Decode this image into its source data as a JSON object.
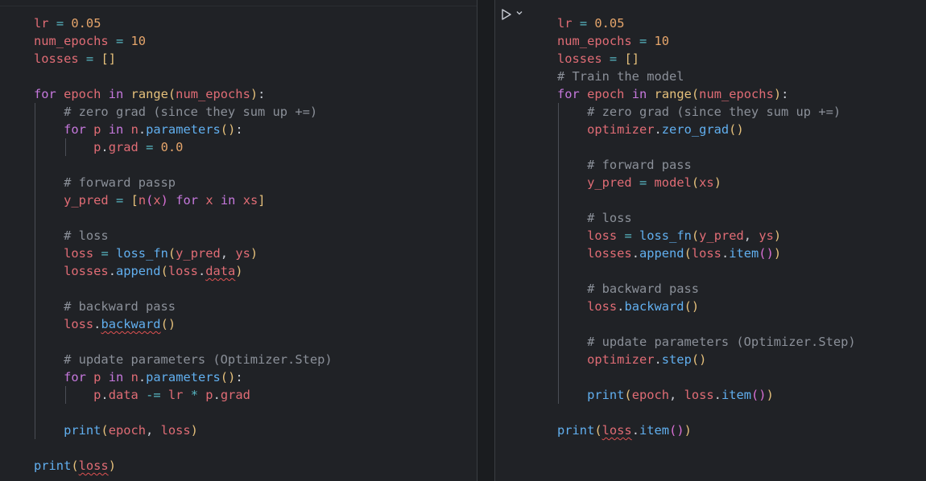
{
  "left_cell": {
    "lines": [
      [
        {
          "t": "lr",
          "c": "var"
        },
        {
          "t": " "
        },
        {
          "t": "=",
          "c": "op"
        },
        {
          "t": " "
        },
        {
          "t": "0.05",
          "c": "num"
        }
      ],
      [
        {
          "t": "num_epochs",
          "c": "var"
        },
        {
          "t": " "
        },
        {
          "t": "=",
          "c": "op"
        },
        {
          "t": " "
        },
        {
          "t": "10",
          "c": "num"
        }
      ],
      [
        {
          "t": "losses",
          "c": "var"
        },
        {
          "t": " "
        },
        {
          "t": "=",
          "c": "op"
        },
        {
          "t": " "
        },
        {
          "t": "[]",
          "c": "br1"
        }
      ],
      [],
      [
        {
          "t": "for",
          "c": "kw"
        },
        {
          "t": " "
        },
        {
          "t": "epoch",
          "c": "var"
        },
        {
          "t": " "
        },
        {
          "t": "in",
          "c": "kw"
        },
        {
          "t": " "
        },
        {
          "t": "range",
          "c": "bi"
        },
        {
          "t": "(",
          "c": "br1"
        },
        {
          "t": "num_epochs",
          "c": "var"
        },
        {
          "t": ")",
          "c": "br1"
        },
        {
          "t": ":"
        }
      ],
      [
        {
          "t": "    "
        },
        {
          "t": "# zero grad (since they sum up +=)",
          "c": "cm"
        }
      ],
      [
        {
          "t": "    "
        },
        {
          "t": "for",
          "c": "kw"
        },
        {
          "t": " "
        },
        {
          "t": "p",
          "c": "var"
        },
        {
          "t": " "
        },
        {
          "t": "in",
          "c": "kw"
        },
        {
          "t": " "
        },
        {
          "t": "n",
          "c": "var"
        },
        {
          "t": "."
        },
        {
          "t": "parameters",
          "c": "fn"
        },
        {
          "t": "()",
          "c": "br1"
        },
        {
          "t": ":"
        }
      ],
      [
        {
          "t": "        "
        },
        {
          "t": "p",
          "c": "var"
        },
        {
          "t": "."
        },
        {
          "t": "grad",
          "c": "var"
        },
        {
          "t": " "
        },
        {
          "t": "=",
          "c": "op"
        },
        {
          "t": " "
        },
        {
          "t": "0.0",
          "c": "num"
        }
      ],
      [],
      [
        {
          "t": "    "
        },
        {
          "t": "# forward passp",
          "c": "cm"
        }
      ],
      [
        {
          "t": "    "
        },
        {
          "t": "y_pred",
          "c": "var"
        },
        {
          "t": " "
        },
        {
          "t": "=",
          "c": "op"
        },
        {
          "t": " "
        },
        {
          "t": "[",
          "c": "br1"
        },
        {
          "t": "n",
          "c": "var"
        },
        {
          "t": "(",
          "c": "br2"
        },
        {
          "t": "x",
          "c": "var"
        },
        {
          "t": ")",
          "c": "br2"
        },
        {
          "t": " "
        },
        {
          "t": "for",
          "c": "kw"
        },
        {
          "t": " "
        },
        {
          "t": "x",
          "c": "var"
        },
        {
          "t": " "
        },
        {
          "t": "in",
          "c": "kw"
        },
        {
          "t": " "
        },
        {
          "t": "xs",
          "c": "var"
        },
        {
          "t": "]",
          "c": "br1"
        }
      ],
      [],
      [
        {
          "t": "    "
        },
        {
          "t": "# loss",
          "c": "cm"
        }
      ],
      [
        {
          "t": "    "
        },
        {
          "t": "loss",
          "c": "var"
        },
        {
          "t": " "
        },
        {
          "t": "=",
          "c": "op"
        },
        {
          "t": " "
        },
        {
          "t": "loss_fn",
          "c": "fn"
        },
        {
          "t": "(",
          "c": "br1"
        },
        {
          "t": "y_pred",
          "c": "var"
        },
        {
          "t": ", "
        },
        {
          "t": "ys",
          "c": "var"
        },
        {
          "t": ")",
          "c": "br1"
        }
      ],
      [
        {
          "t": "    "
        },
        {
          "t": "losses",
          "c": "var"
        },
        {
          "t": "."
        },
        {
          "t": "append",
          "c": "fn"
        },
        {
          "t": "(",
          "c": "br1"
        },
        {
          "t": "loss",
          "c": "var"
        },
        {
          "t": "."
        },
        {
          "t": "data",
          "c": "var",
          "s": true
        },
        {
          "t": ")",
          "c": "br1"
        }
      ],
      [],
      [
        {
          "t": "    "
        },
        {
          "t": "# backward pass",
          "c": "cm"
        }
      ],
      [
        {
          "t": "    "
        },
        {
          "t": "loss",
          "c": "var"
        },
        {
          "t": "."
        },
        {
          "t": "backward",
          "c": "fn",
          "s": true
        },
        {
          "t": "()",
          "c": "br1"
        }
      ],
      [],
      [
        {
          "t": "    "
        },
        {
          "t": "# update parameters (Optimizer.Step)",
          "c": "cm"
        }
      ],
      [
        {
          "t": "    "
        },
        {
          "t": "for",
          "c": "kw"
        },
        {
          "t": " "
        },
        {
          "t": "p",
          "c": "var"
        },
        {
          "t": " "
        },
        {
          "t": "in",
          "c": "kw"
        },
        {
          "t": " "
        },
        {
          "t": "n",
          "c": "var"
        },
        {
          "t": "."
        },
        {
          "t": "parameters",
          "c": "fn"
        },
        {
          "t": "()",
          "c": "br1"
        },
        {
          "t": ":"
        }
      ],
      [
        {
          "t": "        "
        },
        {
          "t": "p",
          "c": "var"
        },
        {
          "t": "."
        },
        {
          "t": "data",
          "c": "var"
        },
        {
          "t": " "
        },
        {
          "t": "-=",
          "c": "op"
        },
        {
          "t": " "
        },
        {
          "t": "lr",
          "c": "var"
        },
        {
          "t": " "
        },
        {
          "t": "*",
          "c": "op"
        },
        {
          "t": " "
        },
        {
          "t": "p",
          "c": "var"
        },
        {
          "t": "."
        },
        {
          "t": "grad",
          "c": "var"
        }
      ],
      [],
      [
        {
          "t": "    "
        },
        {
          "t": "print",
          "c": "fn"
        },
        {
          "t": "(",
          "c": "br1"
        },
        {
          "t": "epoch",
          "c": "var"
        },
        {
          "t": ", "
        },
        {
          "t": "loss",
          "c": "var"
        },
        {
          "t": ")",
          "c": "br1"
        }
      ],
      [],
      [
        {
          "t": "print",
          "c": "fn"
        },
        {
          "t": "(",
          "c": "br1"
        },
        {
          "t": "loss",
          "c": "var",
          "s": true
        },
        {
          "t": ")",
          "c": "br1"
        }
      ]
    ]
  },
  "right_cell": {
    "lines": [
      [
        {
          "t": "lr",
          "c": "var"
        },
        {
          "t": " "
        },
        {
          "t": "=",
          "c": "op"
        },
        {
          "t": " "
        },
        {
          "t": "0.05",
          "c": "num"
        }
      ],
      [
        {
          "t": "num_epochs",
          "c": "var"
        },
        {
          "t": " "
        },
        {
          "t": "=",
          "c": "op"
        },
        {
          "t": " "
        },
        {
          "t": "10",
          "c": "num"
        }
      ],
      [
        {
          "t": "losses",
          "c": "var"
        },
        {
          "t": " "
        },
        {
          "t": "=",
          "c": "op"
        },
        {
          "t": " "
        },
        {
          "t": "[]",
          "c": "br1"
        }
      ],
      [
        {
          "t": "# Train the model",
          "c": "cm"
        }
      ],
      [
        {
          "t": "for",
          "c": "kw"
        },
        {
          "t": " "
        },
        {
          "t": "epoch",
          "c": "var"
        },
        {
          "t": " "
        },
        {
          "t": "in",
          "c": "kw"
        },
        {
          "t": " "
        },
        {
          "t": "range",
          "c": "bi"
        },
        {
          "t": "(",
          "c": "br1"
        },
        {
          "t": "num_epochs",
          "c": "var"
        },
        {
          "t": ")",
          "c": "br1"
        },
        {
          "t": ":"
        }
      ],
      [
        {
          "t": "    "
        },
        {
          "t": "# zero grad (since they sum up +=)",
          "c": "cm"
        }
      ],
      [
        {
          "t": "    "
        },
        {
          "t": "optimizer",
          "c": "var"
        },
        {
          "t": "."
        },
        {
          "t": "zero_grad",
          "c": "fn"
        },
        {
          "t": "()",
          "c": "br1"
        }
      ],
      [],
      [
        {
          "t": "    "
        },
        {
          "t": "# forward pass",
          "c": "cm"
        }
      ],
      [
        {
          "t": "    "
        },
        {
          "t": "y_pred",
          "c": "var"
        },
        {
          "t": " "
        },
        {
          "t": "=",
          "c": "op"
        },
        {
          "t": " "
        },
        {
          "t": "model",
          "c": "var"
        },
        {
          "t": "(",
          "c": "br1"
        },
        {
          "t": "xs",
          "c": "var"
        },
        {
          "t": ")",
          "c": "br1"
        }
      ],
      [],
      [
        {
          "t": "    "
        },
        {
          "t": "# loss",
          "c": "cm"
        }
      ],
      [
        {
          "t": "    "
        },
        {
          "t": "loss",
          "c": "var"
        },
        {
          "t": " "
        },
        {
          "t": "=",
          "c": "op"
        },
        {
          "t": " "
        },
        {
          "t": "loss_fn",
          "c": "fn"
        },
        {
          "t": "(",
          "c": "br1"
        },
        {
          "t": "y_pred",
          "c": "var"
        },
        {
          "t": ", "
        },
        {
          "t": "ys",
          "c": "var"
        },
        {
          "t": ")",
          "c": "br1"
        }
      ],
      [
        {
          "t": "    "
        },
        {
          "t": "losses",
          "c": "var"
        },
        {
          "t": "."
        },
        {
          "t": "append",
          "c": "fn"
        },
        {
          "t": "(",
          "c": "br1"
        },
        {
          "t": "loss",
          "c": "var"
        },
        {
          "t": "."
        },
        {
          "t": "item",
          "c": "fn"
        },
        {
          "t": "()",
          "c": "br2"
        },
        {
          "t": ")",
          "c": "br1"
        }
      ],
      [],
      [
        {
          "t": "    "
        },
        {
          "t": "# backward pass",
          "c": "cm"
        }
      ],
      [
        {
          "t": "    "
        },
        {
          "t": "loss",
          "c": "var"
        },
        {
          "t": "."
        },
        {
          "t": "backward",
          "c": "fn"
        },
        {
          "t": "()",
          "c": "br1"
        }
      ],
      [],
      [
        {
          "t": "    "
        },
        {
          "t": "# update parameters (Optimizer.Step)",
          "c": "cm"
        }
      ],
      [
        {
          "t": "    "
        },
        {
          "t": "optimizer",
          "c": "var"
        },
        {
          "t": "."
        },
        {
          "t": "step",
          "c": "fn"
        },
        {
          "t": "()",
          "c": "br1"
        }
      ],
      [],
      [
        {
          "t": "    "
        },
        {
          "t": "print",
          "c": "fn"
        },
        {
          "t": "(",
          "c": "br1"
        },
        {
          "t": "epoch",
          "c": "var"
        },
        {
          "t": ", "
        },
        {
          "t": "loss",
          "c": "var"
        },
        {
          "t": "."
        },
        {
          "t": "item",
          "c": "fn"
        },
        {
          "t": "()",
          "c": "br2"
        },
        {
          "t": ")",
          "c": "br1"
        }
      ],
      [],
      [
        {
          "t": "print",
          "c": "fn"
        },
        {
          "t": "(",
          "c": "br1"
        },
        {
          "t": "loss",
          "c": "var",
          "s": true
        },
        {
          "t": "."
        },
        {
          "t": "item",
          "c": "fn"
        },
        {
          "t": "()",
          "c": "br2"
        },
        {
          "t": ")",
          "c": "br1"
        }
      ]
    ]
  },
  "toolbar": {
    "run_icon": "play-icon",
    "run_menu_icon": "chevron-down-icon"
  },
  "colors": {
    "background": "#202226",
    "keyword": "#c678dd",
    "variable": "#e06c75",
    "number": "#e5a56b",
    "function": "#61afef",
    "comment": "#8b9099",
    "error": "#e05252"
  }
}
